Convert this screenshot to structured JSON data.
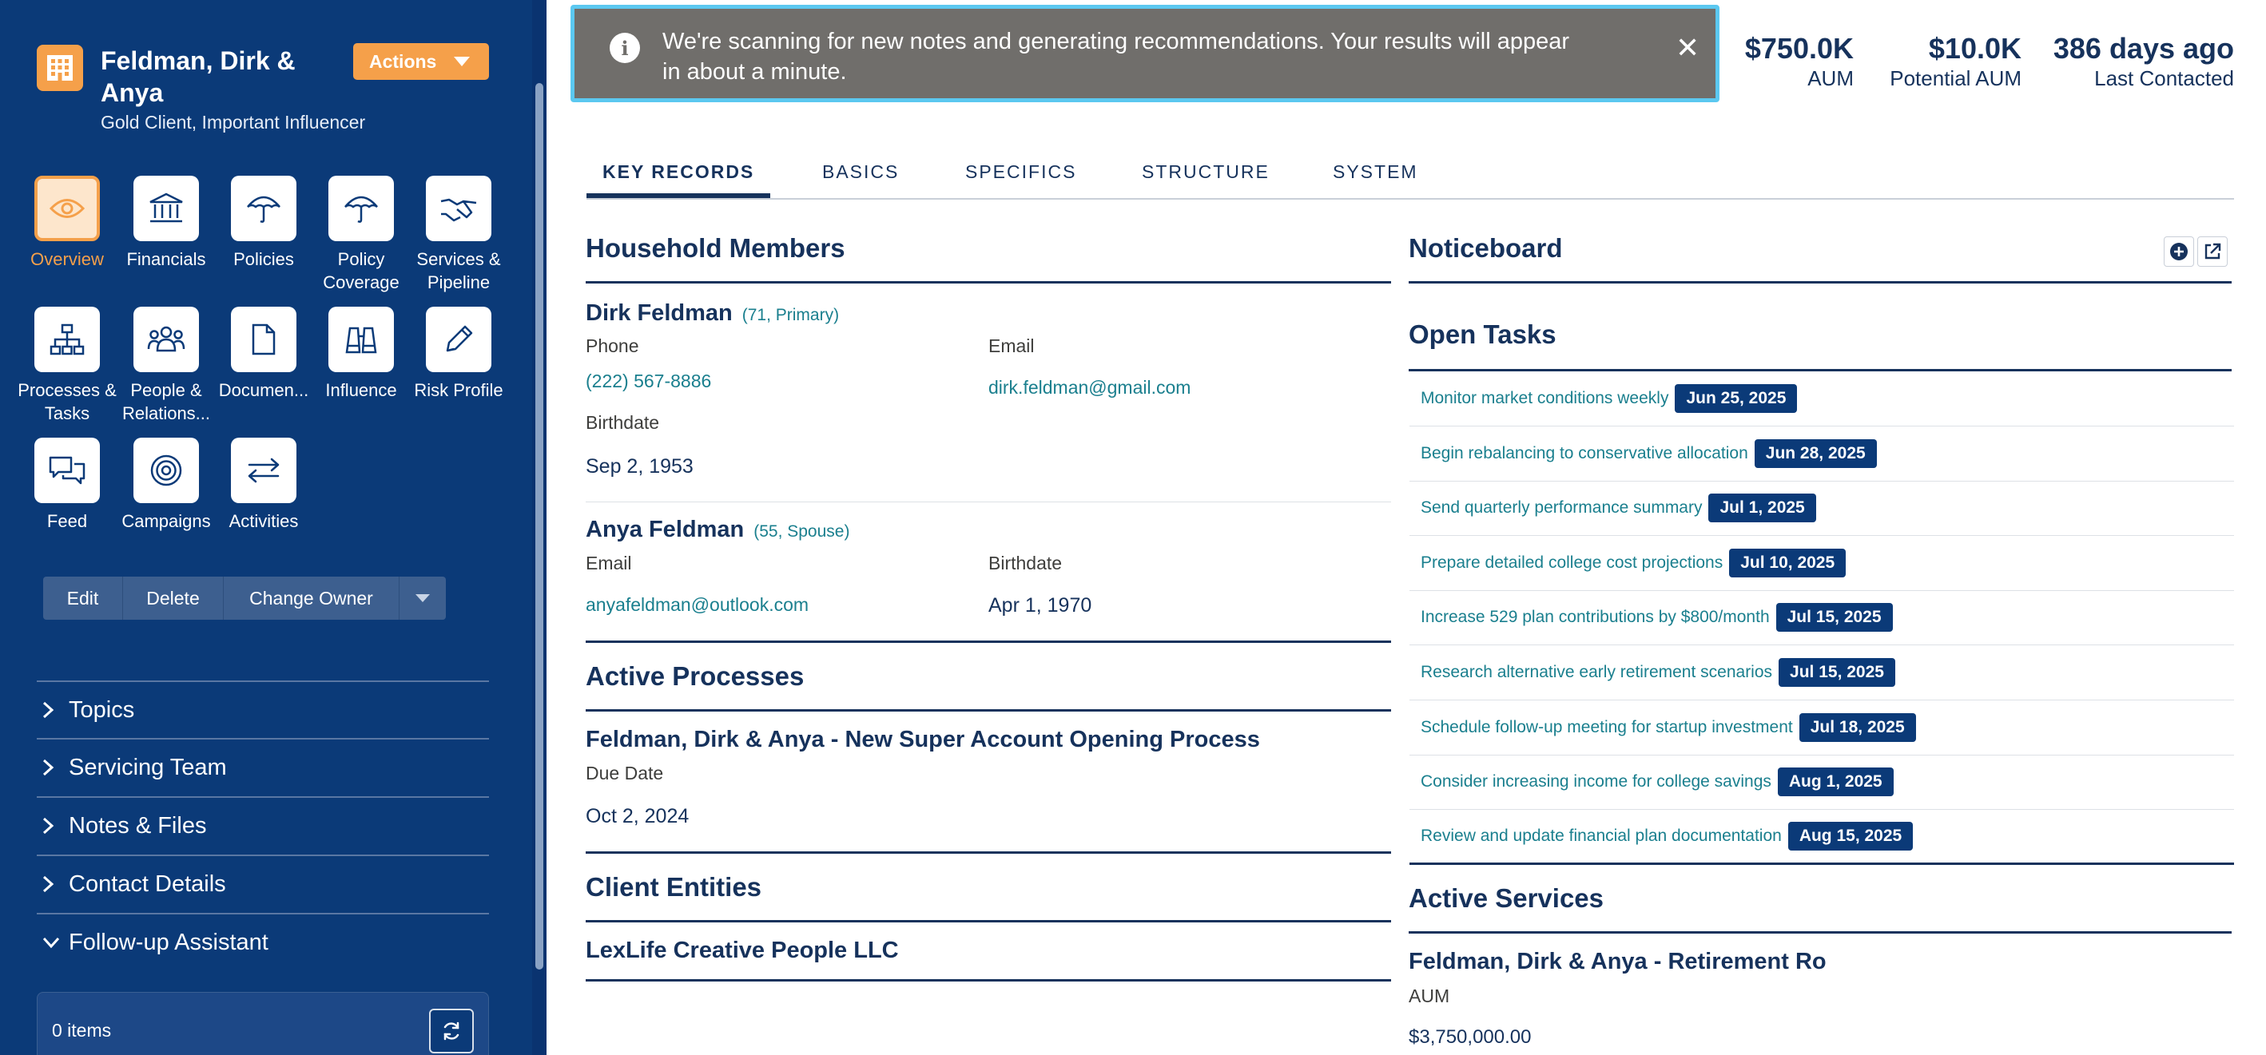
{
  "client": {
    "name": "Feldman, Dirk & Anya",
    "subtitle": "Gold Client, Important Influencer",
    "actions_label": "Actions"
  },
  "nav_tiles": [
    {
      "label": "Overview",
      "icon": "eye-icon"
    },
    {
      "label": "Financials",
      "icon": "bank-icon"
    },
    {
      "label": "Policies",
      "icon": "umbrella-icon"
    },
    {
      "label": "Policy Coverage",
      "icon": "umbrella-icon"
    },
    {
      "label": "Services & Pipeline",
      "icon": "handshake-icon"
    },
    {
      "label": "Processes & Tasks",
      "icon": "hierarchy-icon"
    },
    {
      "label": "People & Relations...",
      "icon": "people-icon"
    },
    {
      "label": "Documen...",
      "icon": "document-icon"
    },
    {
      "label": "Influence",
      "icon": "binoculars-icon"
    },
    {
      "label": "Risk Profile",
      "icon": "pencil-icon"
    },
    {
      "label": "Feed",
      "icon": "chat-icon"
    },
    {
      "label": "Campaigns",
      "icon": "target-icon"
    },
    {
      "label": "Activities",
      "icon": "swap-icon"
    }
  ],
  "record_buttons": {
    "edit": "Edit",
    "delete": "Delete",
    "change_owner": "Change Owner"
  },
  "accordion": [
    {
      "label": "Topics",
      "expanded": false
    },
    {
      "label": "Servicing Team",
      "expanded": false
    },
    {
      "label": "Notes & Files",
      "expanded": false
    },
    {
      "label": "Contact Details",
      "expanded": false
    },
    {
      "label": "Follow-up Assistant",
      "expanded": true
    }
  ],
  "followup": {
    "count_label": "0 items"
  },
  "toast": {
    "message": "We're scanning for new notes and generating recommendations. Your results will appear in about a minute."
  },
  "metrics": [
    {
      "value": "$750.0K",
      "label": "AUM"
    },
    {
      "value": "$10.0K",
      "label": "Potential AUM"
    },
    {
      "value": "386 days ago",
      "label": "Last Contacted"
    }
  ],
  "tabs": [
    "KEY RECORDS",
    "BASICS",
    "SPECIFICS",
    "STRUCTURE",
    "SYSTEM"
  ],
  "household": {
    "title": "Household Members",
    "members": [
      {
        "name": "Dirk Feldman",
        "meta": "(71, Primary)",
        "phone_label": "Phone",
        "phone": "(222) 567-8886",
        "email_label": "Email",
        "email": "dirk.feldman@gmail.com",
        "birth_label": "Birthdate",
        "birthdate": "Sep 2, 1953"
      },
      {
        "name": "Anya Feldman",
        "meta": "(55, Spouse)",
        "email_label": "Email",
        "email": "anyafeldman@outlook.com",
        "birth_label": "Birthdate",
        "birthdate": "Apr 1, 1970"
      }
    ]
  },
  "processes": {
    "title": "Active Processes",
    "name": "Feldman, Dirk & Anya - New Super Account Opening Process",
    "due_label": "Due Date",
    "due": "Oct 2, 2024"
  },
  "entities": {
    "title": "Client Entities",
    "name": "LexLife Creative People LLC"
  },
  "noticeboard": {
    "title": "Noticeboard"
  },
  "open_tasks": {
    "title": "Open Tasks",
    "items": [
      {
        "text": "Monitor market conditions weekly",
        "date": "Jun 25, 2025"
      },
      {
        "text": "Begin rebalancing to conservative allocation",
        "date": "Jun 28, 2025"
      },
      {
        "text": "Send quarterly performance summary",
        "date": "Jul 1, 2025"
      },
      {
        "text": "Prepare detailed college cost projections",
        "date": "Jul 10, 2025"
      },
      {
        "text": "Increase 529 plan contributions by $800/month",
        "date": "Jul 15, 2025"
      },
      {
        "text": "Research alternative early retirement scenarios",
        "date": "Jul 15, 2025"
      },
      {
        "text": "Schedule follow-up meeting for startup investment",
        "date": "Jul 18, 2025"
      },
      {
        "text": "Consider increasing income for college savings",
        "date": "Aug 1, 2025"
      },
      {
        "text": "Review and update financial plan documentation",
        "date": "Aug 15, 2025"
      }
    ]
  },
  "services": {
    "title": "Active Services",
    "name": "Feldman, Dirk & Anya - Retirement Ro",
    "aum_label": "AUM",
    "aum": "$3,750,000.00"
  },
  "colors": {
    "sidebar": "#0b3a78",
    "accent": "#f5a04a",
    "link": "#1a7f8e",
    "heading": "#16325c"
  }
}
